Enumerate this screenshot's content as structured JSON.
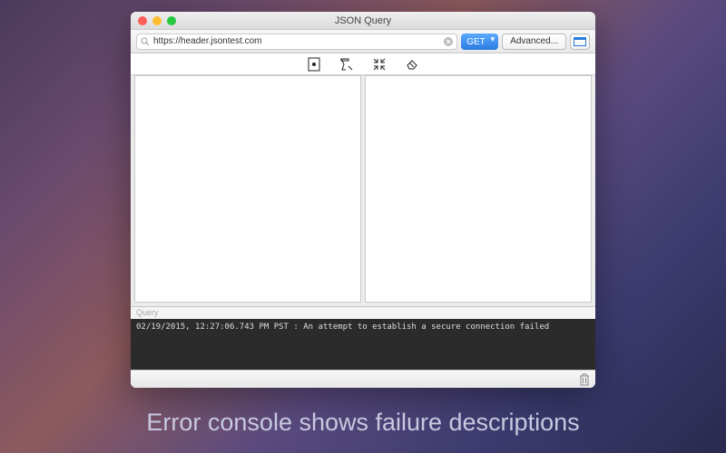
{
  "window": {
    "title": "JSON Query"
  },
  "toolbar": {
    "url": "https://header.jsontest.com",
    "method": "GET",
    "advanced_label": "Advanced..."
  },
  "icons": {
    "prettify": "prettify",
    "brush": "format",
    "compact": "compact",
    "clear": "clear"
  },
  "query_label": "Query",
  "console_line": "02/19/2015, 12:27:06.743 PM PST : An attempt to establish a secure connection failed",
  "caption": "Error console shows failure descriptions"
}
